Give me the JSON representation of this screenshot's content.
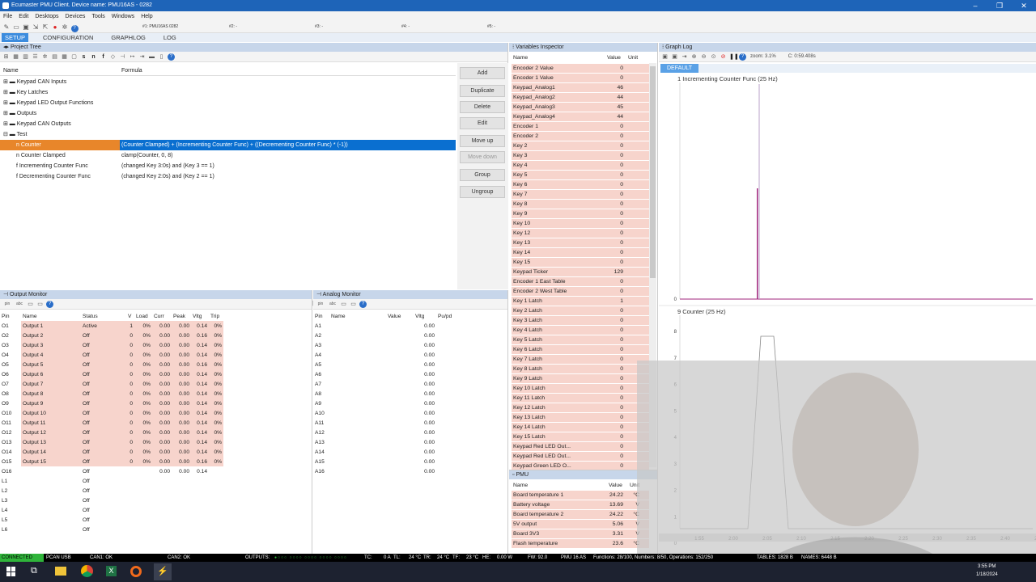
{
  "window": {
    "title": "Ecumaster PMU Client. Device name: PMU16AS - 0282",
    "buttons": [
      "–",
      "❐",
      "✕"
    ]
  },
  "menu": [
    "File",
    "Edit",
    "Desktops",
    "Devices",
    "Tools",
    "Windows",
    "Help"
  ],
  "device_tabs": [
    "#1: PMU16AS 0282",
    "#2: -",
    "#3: -",
    "#4: -",
    "#5: -"
  ],
  "main_tabs": [
    "SETUP",
    "CONFIGURATION",
    "GRAPHLOG",
    "LOG"
  ],
  "project_tree": {
    "header": "Project Tree",
    "toolbar_letters": [
      "s",
      "n",
      "f"
    ],
    "col_name": "Name",
    "col_formula": "Formula",
    "rows": [
      {
        "name": "Keypad CAN Inputs",
        "formula": ""
      },
      {
        "name": "Key Latches",
        "formula": ""
      },
      {
        "name": "Keypad LED Output Functions",
        "formula": ""
      },
      {
        "name": "Outputs",
        "formula": ""
      },
      {
        "name": "Keypad CAN Outputs",
        "formula": ""
      },
      {
        "name": "Test",
        "formula": ""
      },
      {
        "name": "Counter",
        "formula": "(Counter Clamped)  +  (Incrementing Counter Func)  +  ((Decrementing Counter Func) * (-1))"
      },
      {
        "name": "Counter Clamped",
        "formula": "clamp(Counter, 0, 8)"
      },
      {
        "name": "Incrementing Counter Func",
        "formula": "(changed Key 3:0s) and (Key 3 == 1)"
      },
      {
        "name": "Decrementing Counter Func",
        "formula": "(changed Key 2:0s) and (Key 2 == 1)"
      }
    ],
    "buttons": [
      "Add",
      "Duplicate",
      "Delete",
      "Edit",
      "Move up",
      "Move down",
      "Group",
      "Ungroup"
    ]
  },
  "output_monitor": {
    "header": "Output Monitor",
    "toolbar": [
      "pin",
      "abc"
    ],
    "columns": [
      "Pin",
      "Name",
      "Status",
      "V",
      "Load",
      "Curr",
      "Peak",
      "Vltg",
      "Trip"
    ],
    "rows": [
      [
        "O1",
        "Output 1",
        "Active",
        "1",
        "0%",
        "0.00",
        "0.00",
        "0.14",
        "0%"
      ],
      [
        "O2",
        "Output 2",
        "Off",
        "0",
        "0%",
        "0.00",
        "0.00",
        "0.16",
        "0%"
      ],
      [
        "O3",
        "Output 3",
        "Off",
        "0",
        "0%",
        "0.00",
        "0.00",
        "0.14",
        "0%"
      ],
      [
        "O4",
        "Output 4",
        "Off",
        "0",
        "0%",
        "0.00",
        "0.00",
        "0.14",
        "0%"
      ],
      [
        "O5",
        "Output 5",
        "Off",
        "0",
        "0%",
        "0.00",
        "0.00",
        "0.16",
        "0%"
      ],
      [
        "O6",
        "Output 6",
        "Off",
        "0",
        "0%",
        "0.00",
        "0.00",
        "0.14",
        "0%"
      ],
      [
        "O7",
        "Output 7",
        "Off",
        "0",
        "0%",
        "0.00",
        "0.00",
        "0.14",
        "0%"
      ],
      [
        "O8",
        "Output 8",
        "Off",
        "0",
        "0%",
        "0.00",
        "0.00",
        "0.14",
        "0%"
      ],
      [
        "O9",
        "Output 9",
        "Off",
        "0",
        "0%",
        "0.00",
        "0.00",
        "0.14",
        "0%"
      ],
      [
        "O10",
        "Output 10",
        "Off",
        "0",
        "0%",
        "0.00",
        "0.00",
        "0.14",
        "0%"
      ],
      [
        "O11",
        "Output 11",
        "Off",
        "0",
        "0%",
        "0.00",
        "0.00",
        "0.14",
        "0%"
      ],
      [
        "O12",
        "Output 12",
        "Off",
        "0",
        "0%",
        "0.00",
        "0.00",
        "0.14",
        "0%"
      ],
      [
        "O13",
        "Output 13",
        "Off",
        "0",
        "0%",
        "0.00",
        "0.00",
        "0.14",
        "0%"
      ],
      [
        "O14",
        "Output 14",
        "Off",
        "0",
        "0%",
        "0.00",
        "0.00",
        "0.14",
        "0%"
      ],
      [
        "O15",
        "Output 15",
        "Off",
        "0",
        "0%",
        "0.00",
        "0.00",
        "0.16",
        "0%"
      ],
      [
        "O16",
        "",
        "Off",
        "",
        "",
        "0.00",
        "0.00",
        "0.14",
        ""
      ],
      [
        "L1",
        "",
        "Off",
        "",
        "",
        "",
        "",
        "",
        ""
      ],
      [
        "L2",
        "",
        "Off",
        "",
        "",
        "",
        "",
        "",
        ""
      ],
      [
        "L3",
        "",
        "Off",
        "",
        "",
        "",
        "",
        "",
        ""
      ],
      [
        "L4",
        "",
        "Off",
        "",
        "",
        "",
        "",
        "",
        ""
      ],
      [
        "L5",
        "",
        "Off",
        "",
        "",
        "",
        "",
        "",
        ""
      ],
      [
        "L6",
        "",
        "Off",
        "",
        "",
        "",
        "",
        "",
        ""
      ]
    ]
  },
  "analog_monitor": {
    "header": "Analog Monitor",
    "toolbar": [
      "pin",
      "abc"
    ],
    "columns": [
      "Pin",
      "Name",
      "Value",
      "Vltg",
      "Pu/pd"
    ],
    "rows": [
      [
        "A1",
        "",
        "",
        "0.00",
        ""
      ],
      [
        "A2",
        "",
        "",
        "0.00",
        ""
      ],
      [
        "A3",
        "",
        "",
        "0.00",
        ""
      ],
      [
        "A4",
        "",
        "",
        "0.00",
        ""
      ],
      [
        "A5",
        "",
        "",
        "0.00",
        ""
      ],
      [
        "A6",
        "",
        "",
        "0.00",
        ""
      ],
      [
        "A7",
        "",
        "",
        "0.00",
        ""
      ],
      [
        "A8",
        "",
        "",
        "0.00",
        ""
      ],
      [
        "A9",
        "",
        "",
        "0.00",
        ""
      ],
      [
        "A10",
        "",
        "",
        "0.00",
        ""
      ],
      [
        "A11",
        "",
        "",
        "0.00",
        ""
      ],
      [
        "A12",
        "",
        "",
        "0.00",
        ""
      ],
      [
        "A13",
        "",
        "",
        "0.00",
        ""
      ],
      [
        "A14",
        "",
        "",
        "0.00",
        ""
      ],
      [
        "A15",
        "",
        "",
        "0.00",
        ""
      ],
      [
        "A16",
        "",
        "",
        "0.00",
        ""
      ]
    ]
  },
  "variables_inspector": {
    "header": "Variables Inspector",
    "columns": [
      "Name",
      "Value",
      "Unit"
    ],
    "rows": [
      [
        "Encoder 2 Value",
        "0",
        ""
      ],
      [
        "Encoder 1 Value",
        "0",
        ""
      ],
      [
        "Keypad_Analog1",
        "46",
        ""
      ],
      [
        "Keypad_Analog2",
        "44",
        ""
      ],
      [
        "Keypad_Analog3",
        "45",
        ""
      ],
      [
        "Keypad_Analog4",
        "44",
        ""
      ],
      [
        "Encoder 1",
        "0",
        ""
      ],
      [
        "Encoder 2",
        "0",
        ""
      ],
      [
        "Key 2",
        "0",
        ""
      ],
      [
        "Key 3",
        "0",
        ""
      ],
      [
        "Key 4",
        "0",
        ""
      ],
      [
        "Key 5",
        "0",
        ""
      ],
      [
        "Key 6",
        "0",
        ""
      ],
      [
        "Key 7",
        "0",
        ""
      ],
      [
        "Key 8",
        "0",
        ""
      ],
      [
        "Key 9",
        "0",
        ""
      ],
      [
        "Key 10",
        "0",
        ""
      ],
      [
        "Key 12",
        "0",
        ""
      ],
      [
        "Key 13",
        "0",
        ""
      ],
      [
        "Key 14",
        "0",
        ""
      ],
      [
        "Key 15",
        "0",
        ""
      ],
      [
        "Keypad Ticker",
        "129",
        ""
      ],
      [
        "Encoder 1 East Table",
        "0",
        ""
      ],
      [
        "Encoder 2 West Table",
        "0",
        ""
      ],
      [
        "Key 1 Latch",
        "1",
        ""
      ],
      [
        "Key 2 Latch",
        "0",
        ""
      ],
      [
        "Key 3 Latch",
        "0",
        ""
      ],
      [
        "Key 4 Latch",
        "0",
        ""
      ],
      [
        "Key 5 Latch",
        "0",
        ""
      ],
      [
        "Key 6 Latch",
        "0",
        ""
      ],
      [
        "Key 7 Latch",
        "0",
        ""
      ],
      [
        "Key 8 Latch",
        "0",
        ""
      ],
      [
        "Key 9 Latch",
        "0",
        ""
      ],
      [
        "Key 10 Latch",
        "0",
        ""
      ],
      [
        "Key 11 Latch",
        "0",
        ""
      ],
      [
        "Key 12 Latch",
        "0",
        ""
      ],
      [
        "Key 13 Latch",
        "0",
        ""
      ],
      [
        "Key 14 Latch",
        "0",
        ""
      ],
      [
        "Key 15 Latch",
        "0",
        ""
      ],
      [
        "Keypad Red LED Out...",
        "0",
        ""
      ],
      [
        "Keypad Red LED Out...",
        "0",
        ""
      ],
      [
        "Keypad Green LED O...",
        "0",
        ""
      ]
    ]
  },
  "pmu": {
    "header": "PMU",
    "columns": [
      "Name",
      "Value",
      "Unit"
    ],
    "rows": [
      [
        "Board temperature 1",
        "24.22",
        "°C"
      ],
      [
        "Battery voltage",
        "13.69",
        "V"
      ],
      [
        "Board temperature 2",
        "24.22",
        "°C"
      ],
      [
        "5V output",
        "5.06",
        "V"
      ],
      [
        "Board 3V3",
        "3.31",
        "V"
      ],
      [
        "Flash temperature",
        "23.6",
        "°C"
      ]
    ]
  },
  "graph_log": {
    "header": "Graph Log",
    "zoom": "zoom: 3.1%",
    "cursor": "C: 0:59.408s",
    "group_tab": "DEFAULT",
    "ticks_x": [
      "1:55",
      "2:00",
      "2:05",
      "2:10",
      "2:15",
      "2:20",
      "2:25",
      "2:30",
      "2:35",
      "2:40",
      "2:45"
    ]
  },
  "chart_data": [
    {
      "type": "line",
      "title": "1  Incrementing Counter Func (25 Hz)",
      "yticks": [
        "1",
        "0"
      ],
      "ylim": [
        0,
        1
      ]
    },
    {
      "type": "line",
      "title": "9  Counter (25 Hz)",
      "yticks": [
        "8",
        "7",
        "6",
        "5",
        "4",
        "3",
        "2",
        "1",
        "0"
      ],
      "ylim": [
        0,
        8
      ]
    }
  ],
  "statusbar": {
    "connected": "CONNECTED",
    "pcan": "PCAN USB",
    "can1": "CAN1: OK",
    "can2": "CAN2: OK",
    "outputs": "OUTPUTS:",
    "tc": "TC:",
    "tc_val": "0 A",
    "tl": "TL:",
    "tl_val": "24 °C",
    "tr": "TR:",
    "tr_val": "24 °C",
    "tf": "TF:",
    "tf_val": "23 °C",
    "he": "HE:",
    "he_val": "0.00 W",
    "fw": "FW: 92.0",
    "device": "PMU 16 AS",
    "functions": "Functions: 28/100, Numbers: 8/50, Operations: 152/250",
    "tables": "TABLES: 1828 B",
    "names": "NAMES: 6448 B"
  },
  "taskbar": {
    "time": "3:55 PM",
    "date": "1/18/2024"
  },
  "colors": {
    "accent": "#3c8cde",
    "selection": "#0a6fd0",
    "orange": "#e8862a",
    "pink": "#f7d4cc",
    "plot": "#a0267e"
  }
}
